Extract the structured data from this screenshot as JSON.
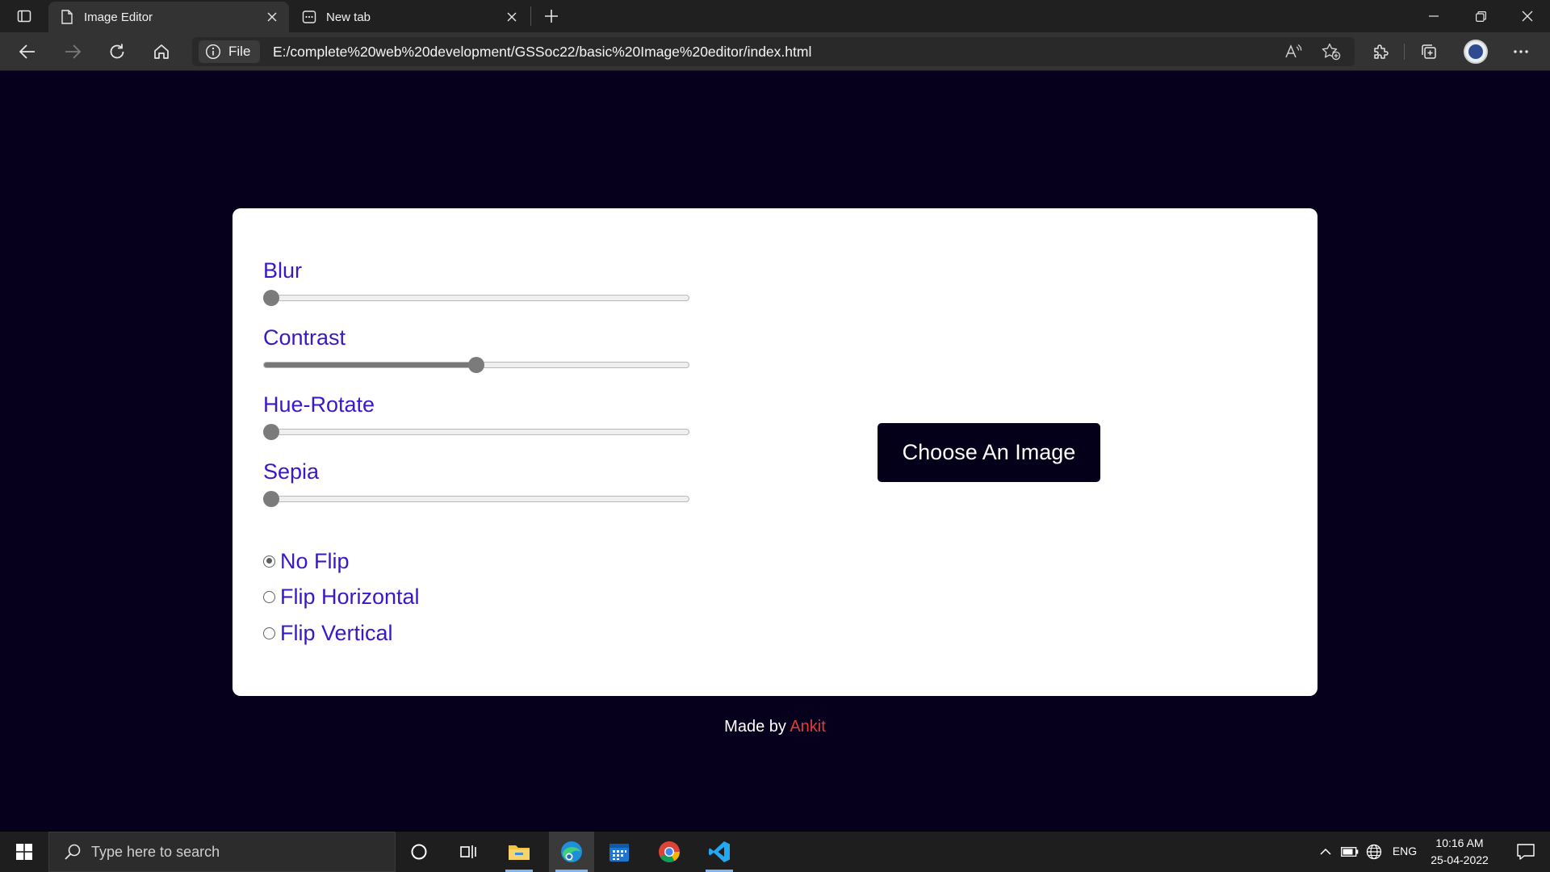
{
  "browser": {
    "tabs": [
      {
        "title": "Image Editor",
        "icon": "page-icon",
        "active": true
      },
      {
        "title": "New tab",
        "icon": "new-tab-page-icon",
        "active": false
      }
    ],
    "site_info_label": "File",
    "url": "E:/complete%20web%20development/GSSoc22/basic%20Image%20editor/index.html"
  },
  "editor": {
    "sliders": [
      {
        "label": "Blur",
        "value_fraction": 0.0
      },
      {
        "label": "Contrast",
        "value_fraction": 0.5
      },
      {
        "label": "Hue-Rotate",
        "value_fraction": 0.0
      },
      {
        "label": "Sepia",
        "value_fraction": 0.0
      }
    ],
    "flip_options": [
      {
        "label": "No Flip",
        "checked": true
      },
      {
        "label": "Flip Horizontal",
        "checked": false
      },
      {
        "label": "Flip Vertical",
        "checked": false
      }
    ],
    "choose_button_label": "Choose An Image"
  },
  "footer": {
    "prefix": "Made by",
    "author": "Ankit"
  },
  "taskbar": {
    "search_placeholder": "Type here to search",
    "language": "ENG",
    "time": "10:16 AM",
    "date": "25-04-2022"
  },
  "colors": {
    "page_background": "#06001c",
    "label_color": "#3a17c8",
    "button_background": "#05001a",
    "author_color": "#e23b3b"
  }
}
